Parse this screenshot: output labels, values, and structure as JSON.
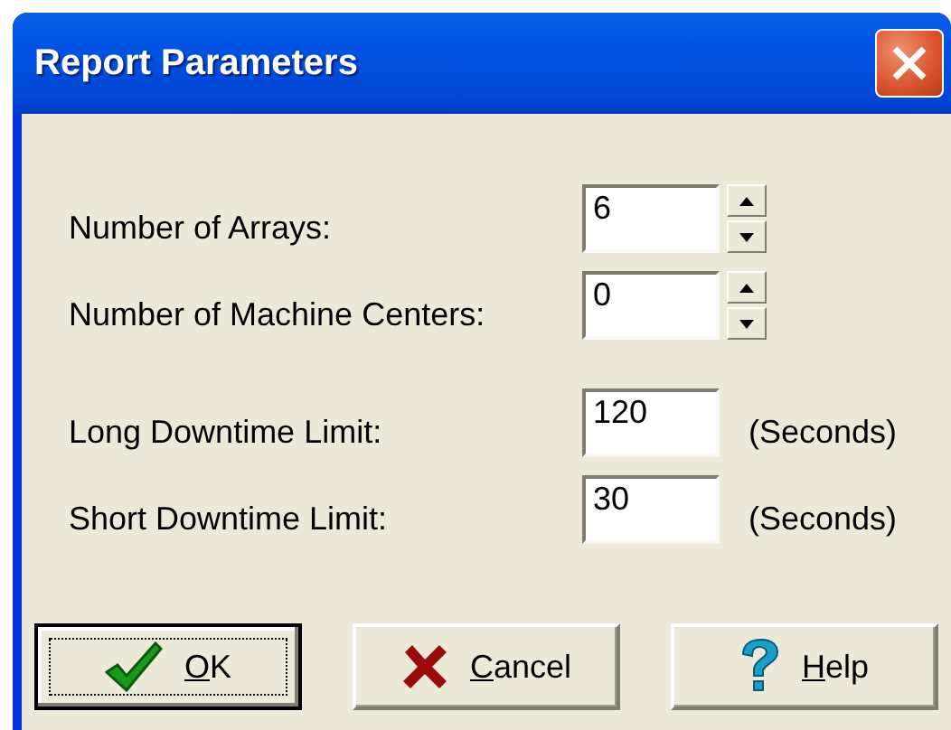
{
  "window": {
    "title": "Report Parameters"
  },
  "fields": [
    {
      "label": "Number of Arrays:",
      "value": "6",
      "kind": "spinner"
    },
    {
      "label": "Number of Machine Centers:",
      "value": "0",
      "kind": "spinner"
    },
    {
      "label": "Long Downtime Limit:",
      "value": "120",
      "kind": "unit",
      "unit": "(Seconds)"
    },
    {
      "label": "Short Downtime Limit:",
      "value": "30",
      "kind": "unit",
      "unit": "(Seconds)"
    }
  ],
  "buttons": [
    {
      "label": "OK",
      "kind": "ok",
      "default": true
    },
    {
      "label": "Cancel",
      "kind": "cancel",
      "default": false
    },
    {
      "label": "Help",
      "kind": "help",
      "default": false
    }
  ]
}
